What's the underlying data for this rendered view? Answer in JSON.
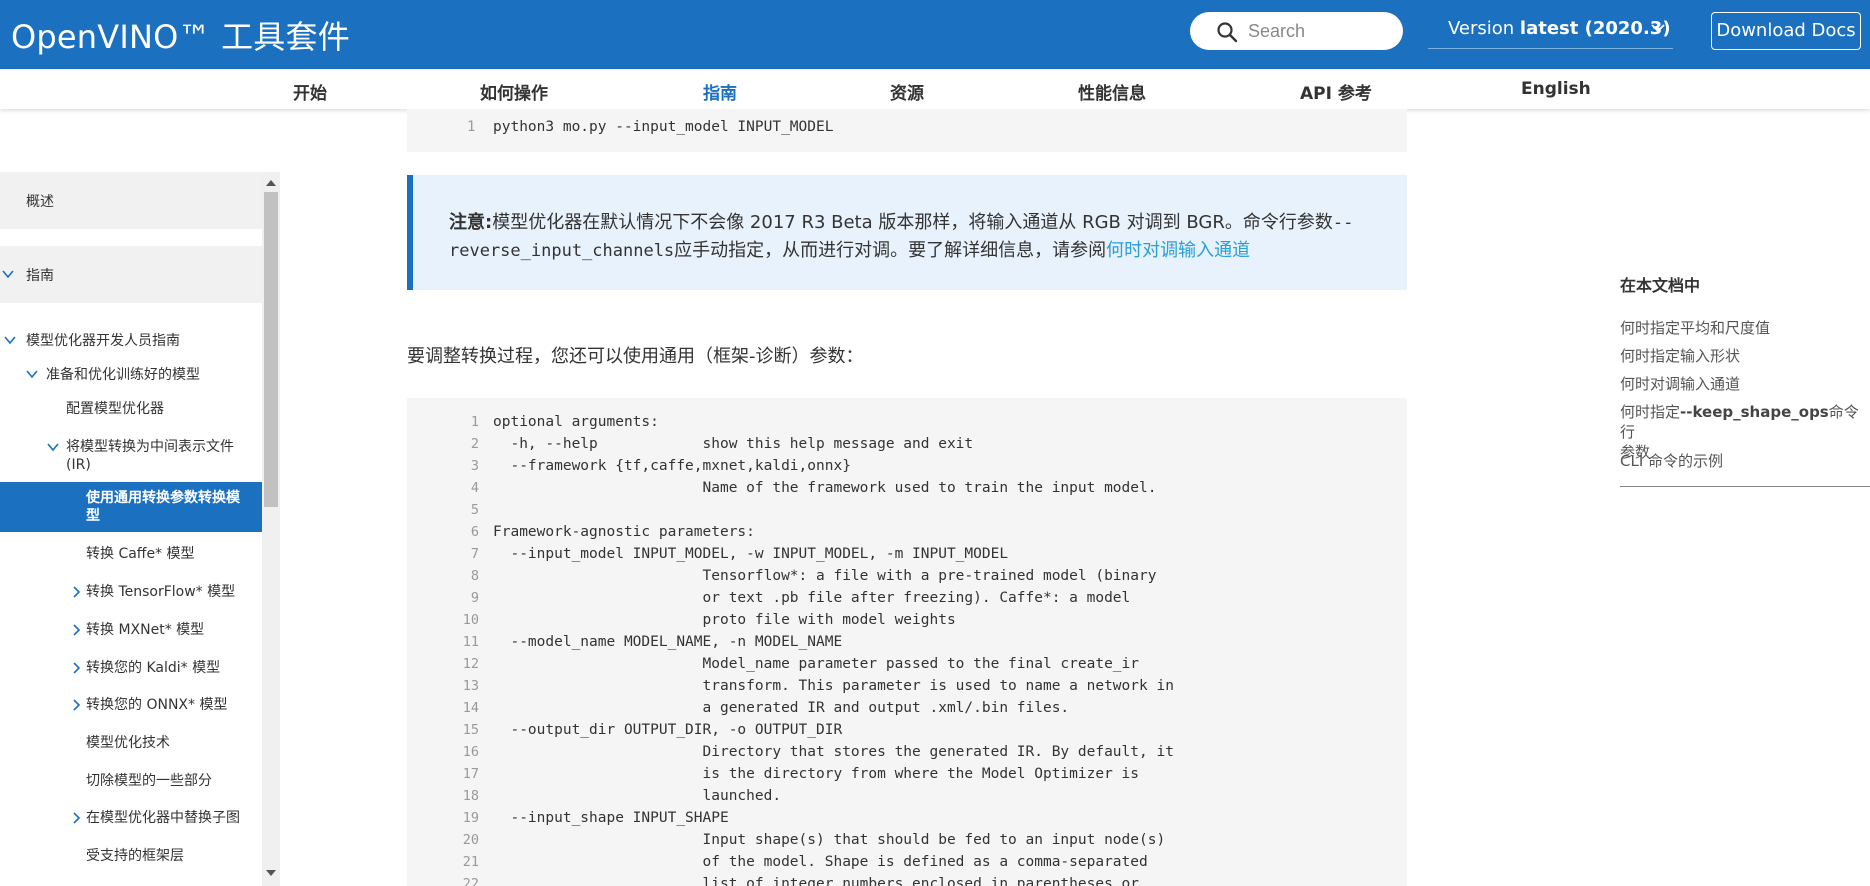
{
  "header": {
    "brand": "OpenVINO™ 工具套件",
    "search_placeholder": "Search",
    "version_prefix": "Version ",
    "version_value": "latest (2020.3)",
    "download": "Download Docs"
  },
  "nav": {
    "items": [
      {
        "label": "开始"
      },
      {
        "label": "如何操作"
      },
      {
        "label": "指南",
        "active": true
      },
      {
        "label": "资源"
      },
      {
        "label": "性能信息"
      },
      {
        "label": "API 参考"
      },
      {
        "label": "English"
      }
    ]
  },
  "sidebar": {
    "items": [
      {
        "label": "概述"
      },
      {
        "label": "指南"
      },
      {
        "label": "模型优化器开发人员指南"
      },
      {
        "label": "准备和优化训练好的模型"
      },
      {
        "label": "配置模型优化器"
      },
      {
        "label": "将模型转换为中间表示文件",
        "label2": "(IR)"
      },
      {
        "label": "使用通用转换参数转换模",
        "label2": "型",
        "active": true
      },
      {
        "label": "转换 Caffe* 模型"
      },
      {
        "label": "转换 TensorFlow* 模型"
      },
      {
        "label": "转换 MXNet* 模型"
      },
      {
        "label": "转换您的 Kaldi* 模型"
      },
      {
        "label": "转换您的 ONNX* 模型"
      },
      {
        "label": "模型优化技术"
      },
      {
        "label": "切除模型的一些部分"
      },
      {
        "label": "在模型优化器中替换子图"
      },
      {
        "label": "受支持的框架层"
      }
    ]
  },
  "main": {
    "top_code": {
      "line": "1",
      "text": "python3 mo.py --input_model INPUT_MODEL"
    },
    "note": {
      "label": "注意:",
      "text1": "模型优化器在默认情况下不会像 2017 R3 Beta 版本那样，将输入通道从 RGB 对调到 BGR。命令行参数",
      "code1": "--",
      "code2": "reverse_input_channels",
      "text2": "应手动指定，从而进行对调。要了解详细信息，请参阅",
      "link": "何时对调输入通道"
    },
    "paragraph": "要调整转换过程，您还可以使用通用（框架-诊断）参数：",
    "code_lines": [
      {
        "n": "1",
        "t": "optional arguments:"
      },
      {
        "n": "2",
        "t": "  -h, --help            show this help message and exit"
      },
      {
        "n": "3",
        "t": "  --framework {tf,caffe,mxnet,kaldi,onnx}"
      },
      {
        "n": "4",
        "t": "                        Name of the framework used to train the input model."
      },
      {
        "n": "5",
        "t": ""
      },
      {
        "n": "6",
        "t": "Framework-agnostic parameters:"
      },
      {
        "n": "7",
        "t": "  --input_model INPUT_MODEL, -w INPUT_MODEL, -m INPUT_MODEL"
      },
      {
        "n": "8",
        "t": "                        Tensorflow*: a file with a pre-trained model (binary"
      },
      {
        "n": "9",
        "t": "                        or text .pb file after freezing). Caffe*: a model"
      },
      {
        "n": "10",
        "t": "                        proto file with model weights"
      },
      {
        "n": "11",
        "t": "  --model_name MODEL_NAME, -n MODEL_NAME"
      },
      {
        "n": "12",
        "t": "                        Model_name parameter passed to the final create_ir"
      },
      {
        "n": "13",
        "t": "                        transform. This parameter is used to name a network in"
      },
      {
        "n": "14",
        "t": "                        a generated IR and output .xml/.bin files."
      },
      {
        "n": "15",
        "t": "  --output_dir OUTPUT_DIR, -o OUTPUT_DIR"
      },
      {
        "n": "16",
        "t": "                        Directory that stores the generated IR. By default, it"
      },
      {
        "n": "17",
        "t": "                        is the directory from where the Model Optimizer is"
      },
      {
        "n": "18",
        "t": "                        launched."
      },
      {
        "n": "19",
        "t": "  --input_shape INPUT_SHAPE"
      },
      {
        "n": "20",
        "t": "                        Input shape(s) that should be fed to an input node(s)"
      },
      {
        "n": "21",
        "t": "                        of the model. Shape is defined as a comma-separated"
      },
      {
        "n": "22",
        "t": "                        list of integer numbers enclosed in parentheses or"
      }
    ]
  },
  "toc": {
    "title": "在本文档中",
    "items": [
      {
        "label": "何时指定平均和尺度值"
      },
      {
        "label": "何时指定输入形状"
      },
      {
        "label": "何时对调输入通道"
      },
      {
        "pre": "何时指定",
        "bold": "--keep_shape_ops",
        "post": "命令行",
        "line2": "参数"
      },
      {
        "label": "CLI 命令的示例"
      }
    ]
  },
  "colors": {
    "brand_blue": "#1b70c0",
    "link": "#2a9fd6",
    "note_bg": "#e8f2fc",
    "code_bg": "#f5f5f5"
  }
}
